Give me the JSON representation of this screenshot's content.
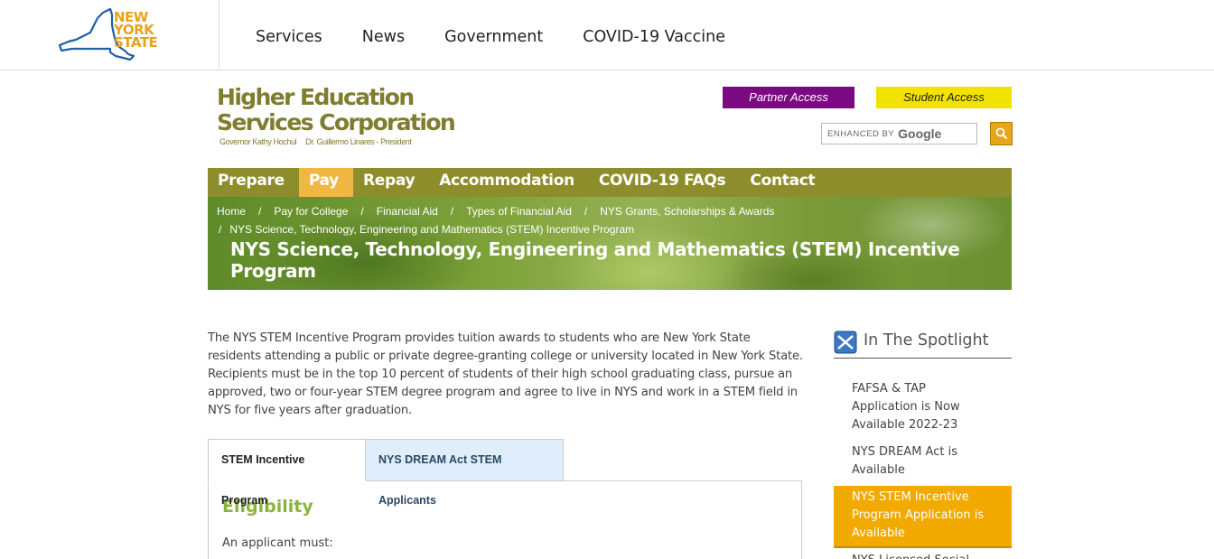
{
  "nys": {
    "logo_text": [
      "NEW",
      "YORK",
      "STATE"
    ],
    "nav": [
      "Services",
      "News",
      "Government",
      "COVID-19 Vaccine"
    ]
  },
  "hesc": {
    "logo_line1": "Higher Education",
    "logo_line2": "Services Corporation",
    "governor": "Governor Kathy Hochul",
    "president": "Dr. Guillermo Linares - President",
    "partner_access": "Partner Access",
    "student_access": "Student Access",
    "search": {
      "enhanced_by": "ENHANCED BY",
      "google": "Google"
    }
  },
  "main_nav": {
    "items": [
      "Prepare",
      "Pay",
      "Repay",
      "Accommodation",
      "COVID-19 FAQs",
      "Contact"
    ],
    "active": "Pay"
  },
  "breadcrumb": [
    "Home",
    "Pay for College",
    "Financial Aid",
    "Types of Financial Aid",
    "NYS Grants, Scholarships & Awards",
    "NYS Science, Technology, Engineering and Mathematics (STEM) Incentive Program"
  ],
  "page_title": "NYS Science, Technology, Engineering and Mathematics (STEM) Incentive Program",
  "intro": "The NYS STEM Incentive Program provides tuition awards to students who are New York State residents attending a public or private degree-granting college or university located in New York State. Recipients must be in the top 10 percent of students of their high school graduating class, pursue an approved, two or four-year STEM degree program and agree to live in NYS and work in a STEM field in NYS for five years after graduation.",
  "tabs": [
    "STEM Incentive Program",
    "NYS DREAM Act STEM Applicants"
  ],
  "panel": {
    "heading": "Eligibility",
    "lead": "An applicant must:"
  },
  "spotlight": {
    "title": "In The Spotlight",
    "items": [
      "FAFSA & TAP Application is Now Available 2022-23",
      "NYS DREAM Act is Available",
      "NYS STEM Incentive Program Application is Available",
      "NYS Licensed Social"
    ]
  },
  "colors": {
    "nav_bg": "#8d8e2b",
    "nav_active": "#f0b843",
    "partner": "#7b0a82",
    "student": "#f2e200",
    "spotlight_hl": "#f2a900",
    "eligibility": "#8ab33c"
  }
}
